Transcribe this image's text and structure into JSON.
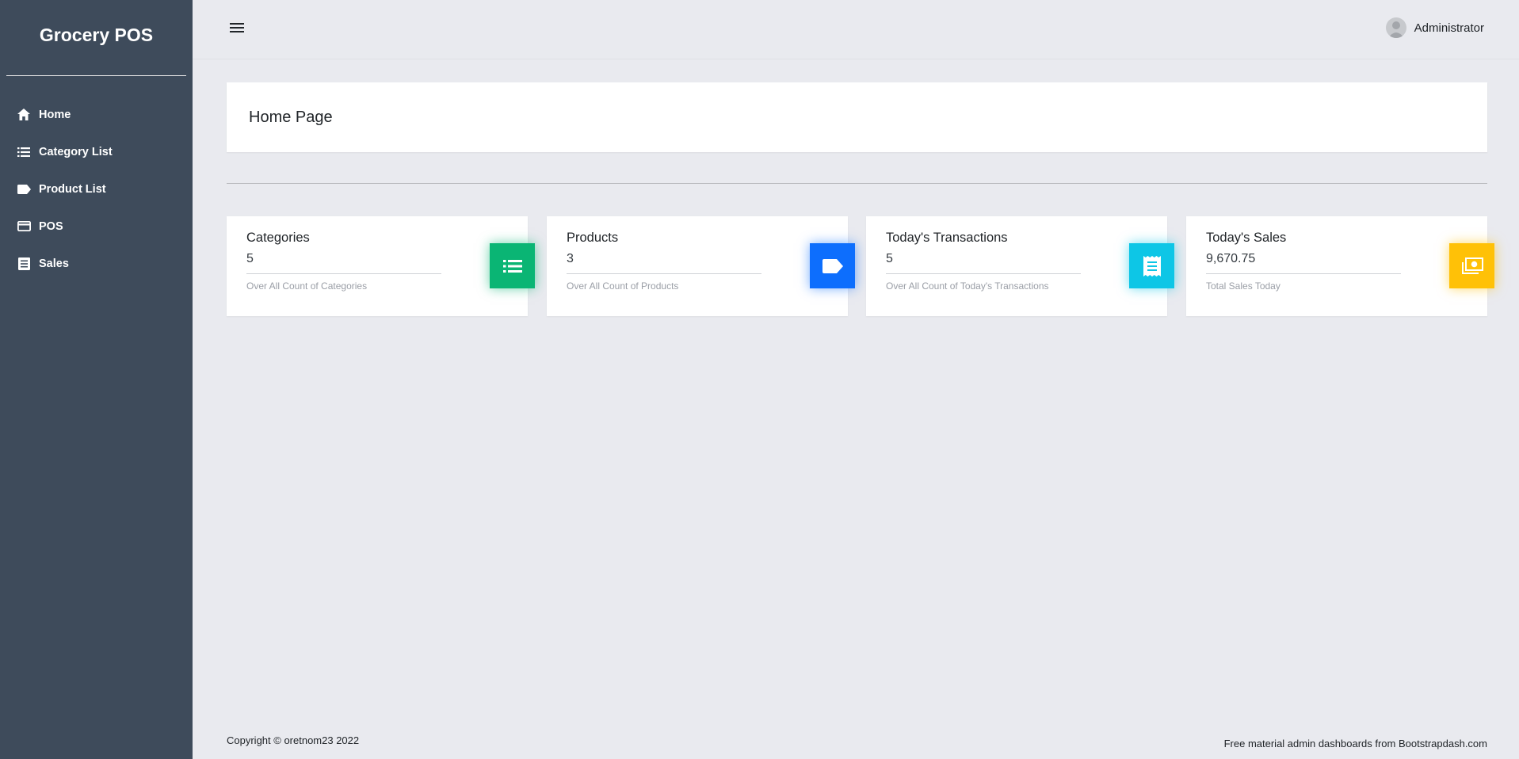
{
  "app": {
    "brand": "Grocery POS"
  },
  "sidebar": {
    "items": [
      {
        "label": "Home",
        "icon": "home-icon"
      },
      {
        "label": "Category List",
        "icon": "list-icon"
      },
      {
        "label": "Product List",
        "icon": "tag-icon"
      },
      {
        "label": "POS",
        "icon": "credit-card-icon"
      },
      {
        "label": "Sales",
        "icon": "receipt-icon"
      }
    ]
  },
  "header": {
    "menu_icon": "hamburger-icon",
    "user_name": "Administrator"
  },
  "main": {
    "title": "Home Page"
  },
  "cards": [
    {
      "title": "Categories",
      "value": "5",
      "description": "Over All Count of Categories",
      "icon": "list-icon",
      "color": "#0ab574"
    },
    {
      "title": "Products",
      "value": "3",
      "description": "Over All Count of Products",
      "icon": "tag-icon",
      "color": "#0d6efd"
    },
    {
      "title": "Today's Transactions",
      "value": "5",
      "description": "Over All Count of Today's Transactions",
      "icon": "receipt-icon",
      "color": "#0dc6e6"
    },
    {
      "title": "Today's Sales",
      "value": "9,670.75",
      "description": "Total Sales Today",
      "icon": "money-icon",
      "color": "#ffc107"
    }
  ],
  "footer": {
    "copyright": "Copyright © oretnom23 2022",
    "credit": "Free material admin dashboards from Bootstrapdash.com"
  },
  "theme": {
    "sidebar_bg": "#3e4b5b",
    "page_bg": "#e9eaef"
  }
}
